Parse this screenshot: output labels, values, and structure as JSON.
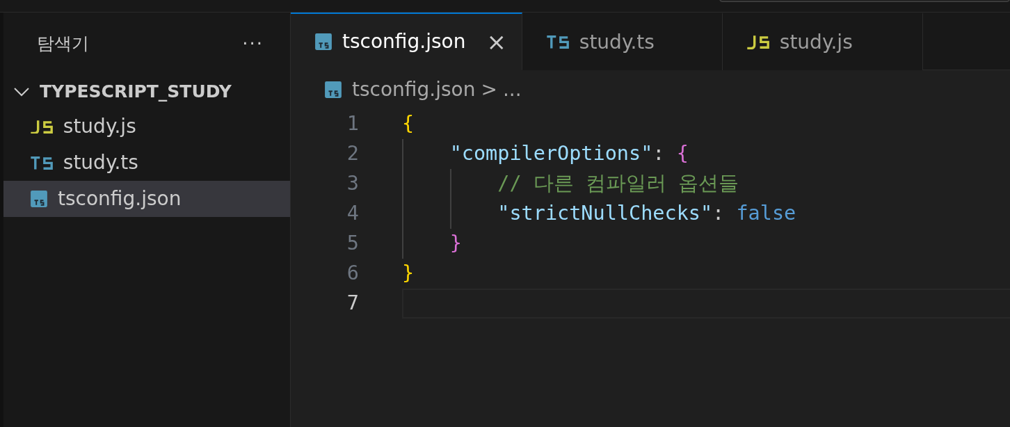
{
  "sidebar": {
    "title": "탐색기",
    "more": "···",
    "folder": {
      "name": "TYPESCRIPT_STUDY",
      "expanded": true,
      "children": [
        {
          "name": "study.js",
          "kind": "js",
          "selected": false
        },
        {
          "name": "study.ts",
          "kind": "ts",
          "selected": false
        },
        {
          "name": "tsconfig.json",
          "kind": "tsconfig",
          "selected": true
        }
      ]
    }
  },
  "tabs": [
    {
      "label": "tsconfig.json",
      "kind": "tsconfig",
      "selected": true,
      "close": "×"
    },
    {
      "label": "study.ts",
      "kind": "ts",
      "selected": false
    },
    {
      "label": "study.js",
      "kind": "js",
      "selected": false
    }
  ],
  "breadcrumb": {
    "kind": "tsconfig",
    "file": "tsconfig.json",
    "separator": ">",
    "more": "..."
  },
  "code_lines": [
    {
      "number": "1",
      "current": false,
      "tokens": [
        {
          "text": "{",
          "kind": "brace1"
        }
      ]
    },
    {
      "number": "2",
      "current": false,
      "kind": "level1",
      "tokens": [
        {
          "text": "\"compilerOptions\"",
          "kind": "key"
        },
        {
          "text": ": ",
          "kind": "punct"
        },
        {
          "text": "{",
          "kind": "brace2"
        }
      ]
    },
    {
      "number": "3",
      "current": false,
      "kind": "level2",
      "tokens": [
        {
          "text": "// 다른 컴파일러 옵션들",
          "kind": "comment"
        }
      ]
    },
    {
      "number": "4",
      "current": false,
      "kind": "level2",
      "tokens": [
        {
          "text": "\"strictNullChecks\"",
          "kind": "key"
        },
        {
          "text": ": ",
          "kind": "punct"
        },
        {
          "text": "false",
          "kind": "keyword"
        }
      ]
    },
    {
      "number": "5",
      "current": false,
      "kind": "level1",
      "tokens": [
        {
          "text": "}",
          "kind": "brace2"
        }
      ]
    },
    {
      "number": "6",
      "current": false,
      "tokens": [
        {
          "text": "}",
          "kind": "brace1"
        }
      ]
    },
    {
      "number": "7",
      "current": true
    }
  ]
}
